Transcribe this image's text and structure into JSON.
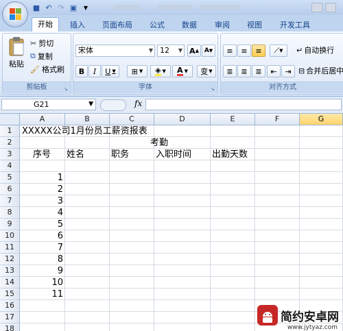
{
  "ribbon_tabs": [
    "开始",
    "插入",
    "页面布局",
    "公式",
    "数据",
    "审阅",
    "视图",
    "开发工具"
  ],
  "clipboard": {
    "paste": "粘贴",
    "cut": "剪切",
    "copy": "复制",
    "format_painter": "格式刷",
    "label": "剪贴板"
  },
  "font": {
    "name": "宋体",
    "size": "12",
    "bold": "B",
    "italic": "I",
    "underline": "U",
    "label": "字体",
    "grow": "A",
    "shrink": "A",
    "phonetic": "变"
  },
  "alignment": {
    "wrap": "自动换行",
    "merge": "合并后居中",
    "label": "对齐方式"
  },
  "namebox": "G21",
  "fx": "fx",
  "columns": [
    "A",
    "B",
    "C",
    "D",
    "E",
    "F",
    "G"
  ],
  "rows": [
    "1",
    "2",
    "3",
    "4",
    "5",
    "6",
    "7",
    "8",
    "9",
    "10",
    "11",
    "12",
    "13",
    "14",
    "15",
    "16",
    "17",
    "18"
  ],
  "cells": {
    "title": "XXXXX公司1月份员工薪资报表",
    "attendance": "考勤",
    "seq_header": "序号",
    "name_header": "姓名",
    "position_header": "职务",
    "hire_date_header": "入职时间",
    "days_header": "出勤天数",
    "seq_numbers": [
      "1",
      "2",
      "3",
      "4",
      "5",
      "6",
      "7",
      "8",
      "9",
      "10",
      "11"
    ]
  },
  "watermark": {
    "text": "简约安卓网",
    "url": "www.jytyaz.com"
  },
  "colors": {
    "accent": "#15428b",
    "selected_header": "#ffd46e",
    "watermark_red": "#c62828"
  }
}
